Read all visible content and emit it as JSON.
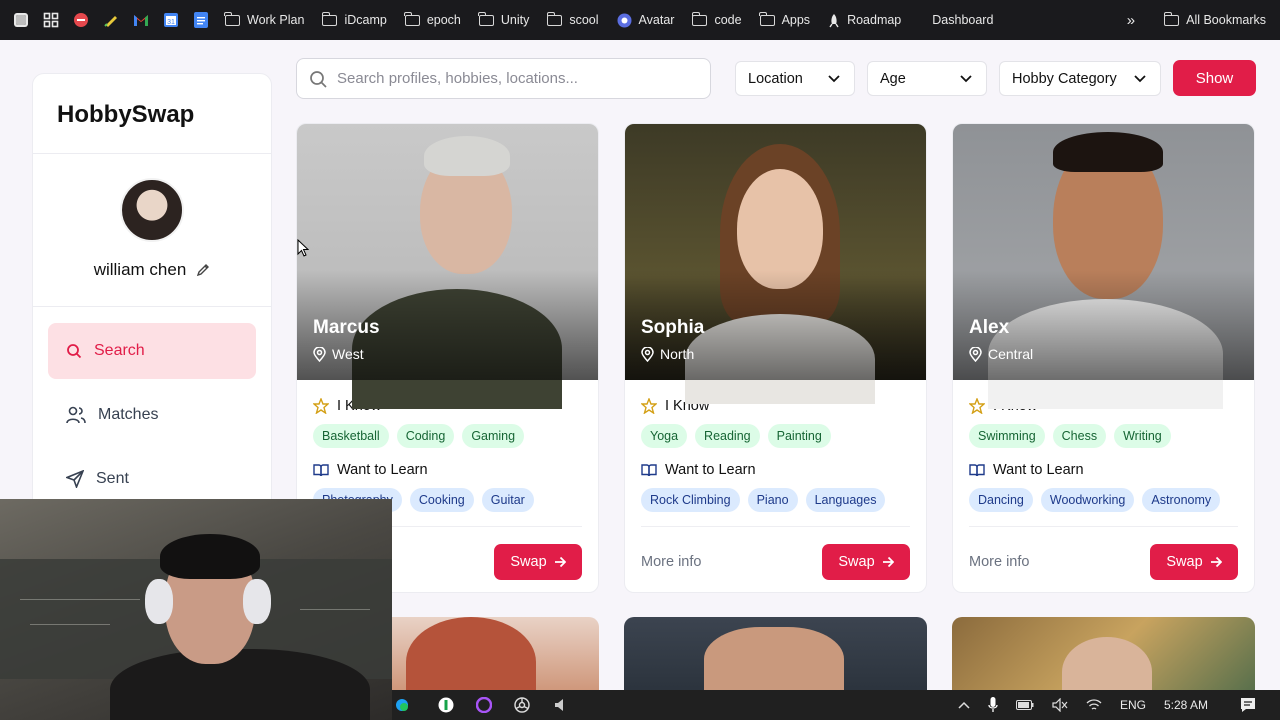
{
  "bookmarks": {
    "items": [
      "Work Plan",
      "iDcamp",
      "epoch",
      "Unity",
      "scool",
      "Avatar",
      "code",
      "Apps",
      "Roadmap",
      "Dashboard"
    ],
    "all_bookmarks": "All Bookmarks",
    "overflow": "»"
  },
  "sidebar": {
    "brand": "HobbySwap",
    "user_name": "william chen",
    "nav": [
      {
        "label": "Search"
      },
      {
        "label": "Matches"
      },
      {
        "label": "Sent"
      }
    ]
  },
  "filters": {
    "search_placeholder": "Search profiles, hobbies, locations...",
    "location": "Location",
    "age": "Age",
    "hobby_category": "Hobby Category",
    "show": "Show"
  },
  "card_labels": {
    "i_know": "I Know",
    "want_to_learn": "Want to Learn",
    "more_info": "More info",
    "swap": "Swap"
  },
  "cards": [
    {
      "name": "Marcus",
      "location": "West",
      "knows": [
        "Basketball",
        "Coding",
        "Gaming"
      ],
      "learn": [
        "Photography",
        "Cooking",
        "Guitar"
      ]
    },
    {
      "name": "Sophia",
      "location": "North",
      "knows": [
        "Yoga",
        "Reading",
        "Painting"
      ],
      "learn": [
        "Rock Climbing",
        "Piano",
        "Languages"
      ]
    },
    {
      "name": "Alex",
      "location": "Central",
      "knows": [
        "Swimming",
        "Chess",
        "Writing"
      ],
      "learn": [
        "Dancing",
        "Woodworking",
        "Astronomy"
      ]
    }
  ],
  "taskbar": {
    "language": "ENG",
    "time": "5:28 AM"
  },
  "colors": {
    "accent": "#e11d48",
    "active_nav_bg": "#fde0e4",
    "know_tag_bg": "#dcfce7",
    "learn_tag_bg": "#dbeafe"
  }
}
